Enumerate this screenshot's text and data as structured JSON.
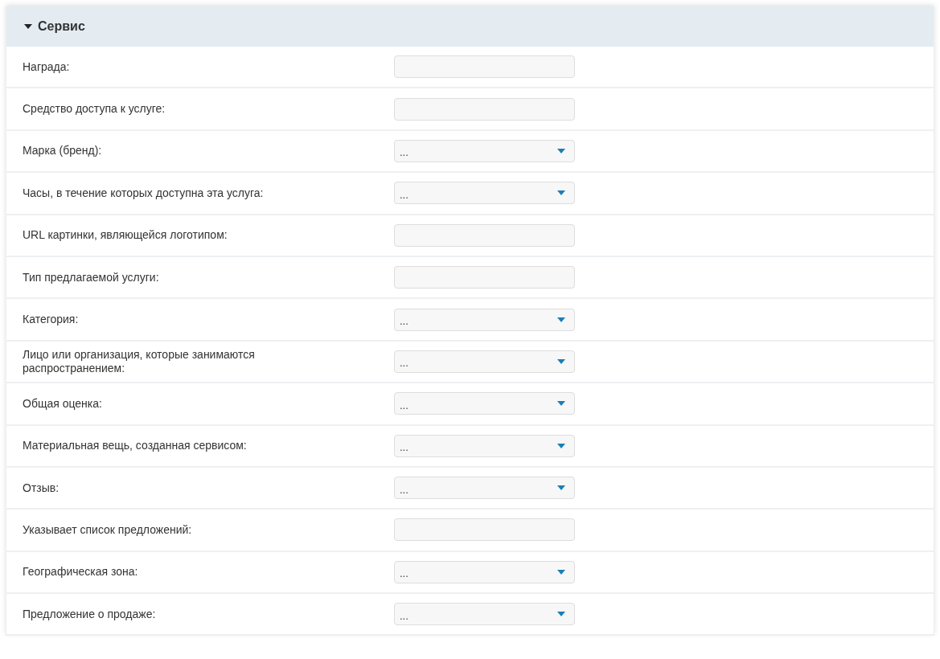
{
  "section": {
    "title": "Сервис",
    "expanded": true
  },
  "fields": [
    {
      "label": "Награда:",
      "kind": "text"
    },
    {
      "label": "Средство доступа к услуге:",
      "kind": "text"
    },
    {
      "label": "Марка (бренд):",
      "kind": "select",
      "value": "..."
    },
    {
      "label": "Часы, в течение которых доступна эта услуга:",
      "kind": "select",
      "value": "..."
    },
    {
      "label": "URL картинки, являющейся логотипом:",
      "kind": "text"
    },
    {
      "label": "Тип предлагаемой услуги:",
      "kind": "text"
    },
    {
      "label": "Категория:",
      "kind": "select",
      "value": "..."
    },
    {
      "label": "Лицо или организация, которые занимаются распространением:",
      "kind": "select",
      "value": "..."
    },
    {
      "label": "Общая оценка:",
      "kind": "select",
      "value": "..."
    },
    {
      "label": "Материальная вещь, созданная сервисом:",
      "kind": "select",
      "value": "..."
    },
    {
      "label": "Отзыв:",
      "kind": "select",
      "value": "..."
    },
    {
      "label": "Указывает список предложений:",
      "kind": "text"
    },
    {
      "label": "Географическая зона:",
      "kind": "select",
      "value": "..."
    },
    {
      "label": "Предложение о продаже:",
      "kind": "select",
      "value": "..."
    }
  ]
}
